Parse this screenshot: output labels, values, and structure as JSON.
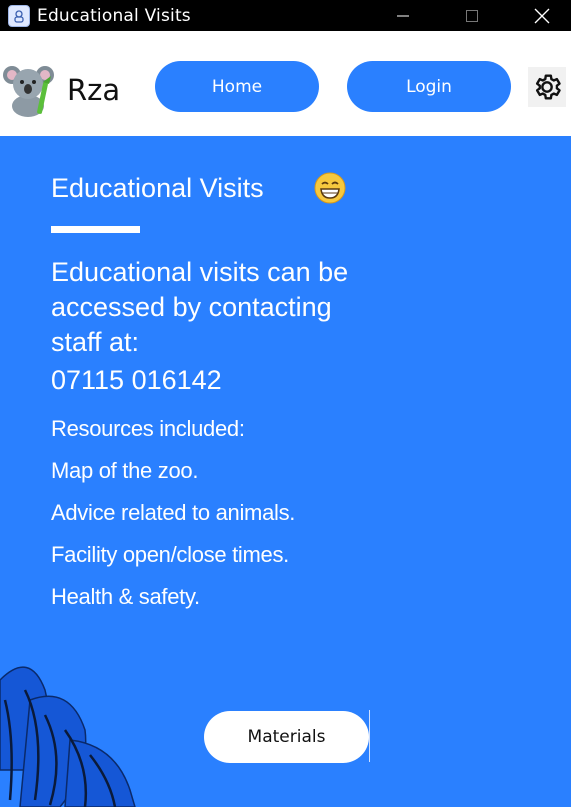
{
  "window": {
    "title": "Educational Visits",
    "controls": [
      "minimize-icon",
      "maximize-icon",
      "close-icon"
    ]
  },
  "header": {
    "brand": "Rza",
    "nav": {
      "home": "Home",
      "login": "Login"
    },
    "settings_icon": "gear-icon"
  },
  "main": {
    "heading": "Educational Visits",
    "heading_emoji": "grinning-face-icon",
    "intro": "Educational visits can be accessed by contacting staff at:",
    "phone": "07115 016142",
    "resources_title": "Resources included:",
    "resources": [
      "Map of the zoo.",
      "Advice related to animals.",
      "Facility open/close times.",
      "Health & safety."
    ],
    "materials_button": "Materials"
  },
  "colors": {
    "background": "#2a80ff",
    "header": "#ffffff",
    "titlebar": "#000000",
    "button": "#2a80ff"
  }
}
